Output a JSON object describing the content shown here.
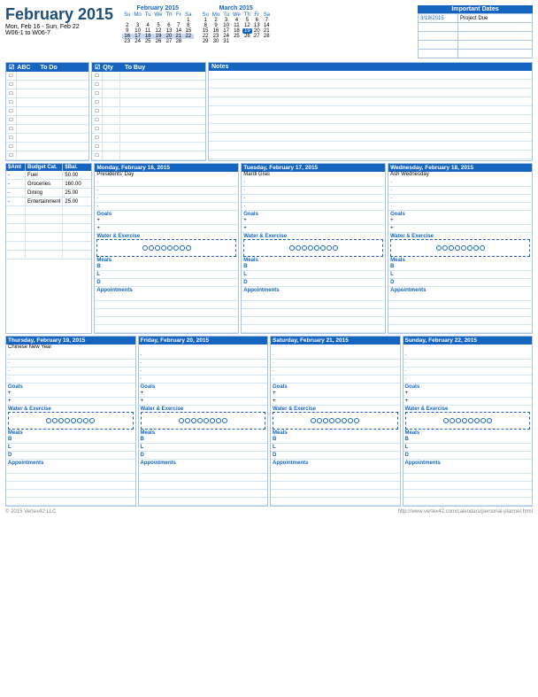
{
  "header": {
    "title": "February 2015",
    "week_range": "Mon, Feb 16 - Sun, Feb 22",
    "week_code": "W06-1 to W06-7"
  },
  "feb_cal": {
    "title": "February 2015",
    "days_header": [
      "Su",
      "Mo",
      "Tu",
      "We",
      "Th",
      "Fr",
      "Sa"
    ],
    "weeks": [
      [
        "1",
        "2",
        "3",
        "4",
        "5",
        "6",
        "7"
      ],
      [
        "8",
        "9",
        "10",
        "11",
        "12",
        "13",
        "14"
      ],
      [
        "15",
        "16",
        "17",
        "18",
        "19",
        "20",
        "21"
      ],
      [
        "22",
        "23",
        "24",
        "25",
        "26",
        "27",
        "28"
      ]
    ],
    "highlight_row": 2,
    "highlight_cells": [
      "16",
      "17",
      "18",
      "19",
      "20",
      "21",
      "22"
    ]
  },
  "mar_cal": {
    "title": "March 2015",
    "days_header": [
      "Su",
      "Mo",
      "Tu",
      "We",
      "Th",
      "Fr",
      "Sa"
    ],
    "weeks": [
      [
        "1",
        "2",
        "3",
        "4",
        "5",
        "6",
        "7"
      ],
      [
        "8",
        "9",
        "10",
        "11",
        "12",
        "13",
        "14"
      ],
      [
        "15",
        "16",
        "17",
        "18",
        "19",
        "20",
        "21"
      ],
      [
        "22",
        "23",
        "24",
        "25",
        "26",
        "27",
        "28"
      ],
      [
        "29",
        "30",
        "31",
        "",
        "",
        "",
        ""
      ]
    ]
  },
  "important_dates": {
    "title": "Important Dates",
    "rows": [
      {
        "date": "3/19/2015",
        "event": "Project Due"
      },
      {
        "date": "",
        "event": ""
      },
      {
        "date": "",
        "event": ""
      },
      {
        "date": "",
        "event": ""
      },
      {
        "date": "",
        "event": ""
      }
    ]
  },
  "todo": {
    "header": "ABC",
    "col_label": "To Do",
    "items": [
      "",
      "",
      "",
      "",
      "",
      "",
      "",
      "",
      "",
      ""
    ]
  },
  "tobuy": {
    "qty_label": "Qty",
    "col_label": "To Buy",
    "items": [
      "",
      "",
      "",
      "",
      "",
      "",
      "",
      "",
      "",
      ""
    ]
  },
  "notes": {
    "header": "Notes",
    "lines": [
      "",
      "",
      "",
      "",
      "",
      "",
      "",
      "",
      "",
      ""
    ]
  },
  "budget": {
    "headers": [
      "$Amt",
      "Budget Cat.",
      "$Bal."
    ],
    "rows": [
      {
        "amt": "-",
        "cat": "Fuel",
        "bal": "50.00"
      },
      {
        "amt": "-",
        "cat": "Groceries",
        "bal": "160.00"
      },
      {
        "amt": "-",
        "cat": "Dining",
        "bal": "25.00"
      },
      {
        "amt": "-",
        "cat": "Entertainment",
        "bal": "25.00"
      },
      {
        "amt": "",
        "cat": "",
        "bal": ""
      },
      {
        "amt": "",
        "cat": "",
        "bal": ""
      },
      {
        "amt": "",
        "cat": "",
        "bal": ""
      },
      {
        "amt": "",
        "cat": "",
        "bal": ""
      },
      {
        "amt": "",
        "cat": "",
        "bal": ""
      },
      {
        "amt": "",
        "cat": "",
        "bal": ""
      }
    ]
  },
  "days_row1": [
    {
      "header": "Monday, February 16, 2015",
      "holiday": "Presidents' Day",
      "dot_lines": 4,
      "goals_label": "Goals",
      "goal_items": [
        "+",
        "+"
      ],
      "water_label": "Water & Exercise",
      "meals_label": "Meals",
      "meals": [
        "B",
        "L",
        "D"
      ],
      "appointments_label": "Appointments",
      "appt_lines": 5
    },
    {
      "header": "Tuesday, February 17, 2015",
      "holiday": "Mardi Gras",
      "dot_lines": 4,
      "goals_label": "Goals",
      "goal_items": [
        "+",
        "+"
      ],
      "water_label": "Water & Exercise",
      "meals_label": "Meals",
      "meals": [
        "B",
        "L",
        "D"
      ],
      "appointments_label": "Appointments",
      "appt_lines": 5
    },
    {
      "header": "Wednesday, February 18, 2015",
      "holiday": "Ash Wednesday",
      "dot_lines": 4,
      "goals_label": "Goals",
      "goal_items": [
        "+",
        "+"
      ],
      "water_label": "Water & Exercise",
      "meals_label": "Meals",
      "meals": [
        "B",
        "L",
        "D"
      ],
      "appointments_label": "Appointments",
      "appt_lines": 5
    }
  ],
  "days_row2": [
    {
      "header": "Thursday, February 19, 2015",
      "holiday": "Chinese New Year",
      "dot_lines": 4,
      "goals_label": "Goals",
      "goal_items": [
        "+",
        "+"
      ],
      "water_label": "Water & Exercise",
      "meals_label": "Meals",
      "meals": [
        "B",
        "L",
        "D"
      ],
      "appointments_label": "Appointments",
      "appt_lines": 5
    },
    {
      "header": "Friday, February 20, 2015",
      "holiday": "",
      "dot_lines": 4,
      "goals_label": "Goals",
      "goal_items": [
        "+",
        "+"
      ],
      "water_label": "Water & Exercise",
      "meals_label": "Meals",
      "meals": [
        "B",
        "L",
        "D"
      ],
      "appointments_label": "Appointments",
      "appt_lines": 5
    },
    {
      "header": "Saturday, February 21, 2015",
      "holiday": "",
      "dot_lines": 4,
      "goals_label": "Goals",
      "goal_items": [
        "+",
        "+"
      ],
      "water_label": "Water & Exercise",
      "meals_label": "Meals",
      "meals": [
        "B",
        "L",
        "D"
      ],
      "appointments_label": "Appointments",
      "appt_lines": 5
    },
    {
      "header": "Sunday, February 22, 2015",
      "holiday": "",
      "dot_lines": 4,
      "goals_label": "Goals",
      "goal_items": [
        "+",
        "+"
      ],
      "water_label": "Water & Exercise",
      "meals_label": "Meals",
      "meals": [
        "B",
        "L",
        "D"
      ],
      "appointments_label": "Appointments",
      "appt_lines": 5
    }
  ],
  "footer": {
    "copyright": "© 2015 Vertex42 LLC",
    "url": "http://www.vertex42.com/calendars/personal-planner.html"
  }
}
